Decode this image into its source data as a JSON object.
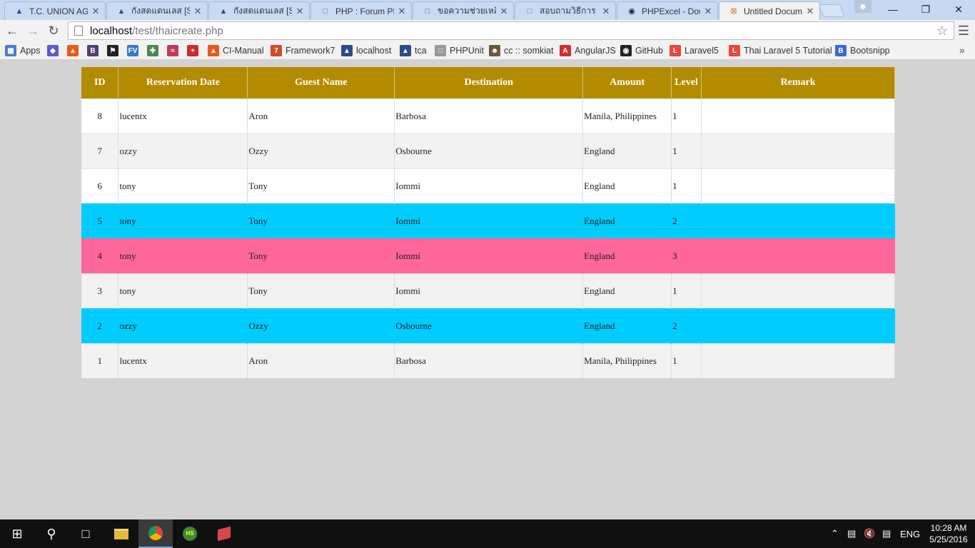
{
  "tabs": [
    {
      "title": "T.C. UNION AGR",
      "icon": "site-logo-icon"
    },
    {
      "title": "กังสดแดนเลส [Stoc",
      "icon": "site-logo-icon"
    },
    {
      "title": "กังสดแดนเลส [Stoc",
      "icon": "site-logo-icon"
    },
    {
      "title": "PHP : Forum PH",
      "icon": "page-icon"
    },
    {
      "title": "ขอความช่วยเหลือ",
      "icon": "page-icon"
    },
    {
      "title": "สอบถามวิธีการ ทำ",
      "icon": "page-icon"
    },
    {
      "title": "PHPExcel - Dow",
      "icon": "github-icon"
    },
    {
      "title": "Untitled Docum",
      "icon": "xampp-icon"
    }
  ],
  "address": {
    "host": "localhost",
    "path": "/test/thaicreate.php"
  },
  "bookmarks": [
    {
      "label": "Apps",
      "icon": "apps-grid-icon"
    },
    {
      "label": "",
      "icon": "diamond-icon"
    },
    {
      "label": "",
      "icon": "flame-icon"
    },
    {
      "label": "",
      "icon": "bootstrap-icon"
    },
    {
      "label": "",
      "icon": "flag-icon"
    },
    {
      "label": "",
      "icon": "fv-icon"
    },
    {
      "label": "",
      "icon": "network-icon"
    },
    {
      "label": "",
      "icon": "wave-icon"
    },
    {
      "label": "",
      "icon": "plus-icon"
    },
    {
      "label": "CI-Manual",
      "icon": "flame-icon"
    },
    {
      "label": "Framework7",
      "icon": "framework7-icon"
    },
    {
      "label": "localhost",
      "icon": "site-logo-icon"
    },
    {
      "label": "tca",
      "icon": "site-logo-icon"
    },
    {
      "label": "PHPUnit",
      "icon": "page-icon"
    },
    {
      "label": "cc :: somkiat",
      "icon": "avatar-icon"
    },
    {
      "label": "AngularJS",
      "icon": "angular-icon"
    },
    {
      "label": "GitHub",
      "icon": "github-icon"
    },
    {
      "label": "Laravel5",
      "icon": "laravel-icon"
    },
    {
      "label": "Thai Laravel 5 Tutorial",
      "icon": "laravel-icon"
    },
    {
      "label": "Bootsnipp",
      "icon": "bootsnipp-icon"
    }
  ],
  "table": {
    "headers": [
      "ID",
      "Reservation Date",
      "Guest Name",
      "Destination",
      "Amount",
      "Level",
      "Remark"
    ],
    "rows": [
      {
        "id": "8",
        "reservation_date": "lucentx",
        "guest_name": "Aron",
        "destination": "Barbosa",
        "amount": "Manila, Philippines",
        "level": "1",
        "remark": "",
        "highlight": "none"
      },
      {
        "id": "7",
        "reservation_date": "ozzy",
        "guest_name": "Ozzy",
        "destination": "Osbourne",
        "amount": "England",
        "level": "1",
        "remark": "",
        "highlight": "none"
      },
      {
        "id": "6",
        "reservation_date": "tony",
        "guest_name": "Tony",
        "destination": "Iommi",
        "amount": "England",
        "level": "1",
        "remark": "",
        "highlight": "none"
      },
      {
        "id": "5",
        "reservation_date": "tony",
        "guest_name": "Tony",
        "destination": "Iommi",
        "amount": "England",
        "level": "2",
        "remark": "",
        "highlight": "blue"
      },
      {
        "id": "4",
        "reservation_date": "tony",
        "guest_name": "Tony",
        "destination": "Iommi",
        "amount": "England",
        "level": "3",
        "remark": "",
        "highlight": "pink"
      },
      {
        "id": "3",
        "reservation_date": "tony",
        "guest_name": "Tony",
        "destination": "Iommi",
        "amount": "England",
        "level": "1",
        "remark": "",
        "highlight": "none"
      },
      {
        "id": "2",
        "reservation_date": "ozzy",
        "guest_name": "Ozzy",
        "destination": "Osbourne",
        "amount": "England",
        "level": "2",
        "remark": "",
        "highlight": "blue"
      },
      {
        "id": "1",
        "reservation_date": "lucentx",
        "guest_name": "Aron",
        "destination": "Barbosa",
        "amount": "Manila, Philippines",
        "level": "1",
        "remark": "",
        "highlight": "none"
      }
    ]
  },
  "colors": {
    "header": "#b38b00",
    "level2": "#00ccff",
    "level3": "#ff6699",
    "page_bg": "#d3d3d3"
  },
  "taskbar": {
    "language": "ENG",
    "time": "10:28 AM",
    "date": "5/25/2016"
  }
}
